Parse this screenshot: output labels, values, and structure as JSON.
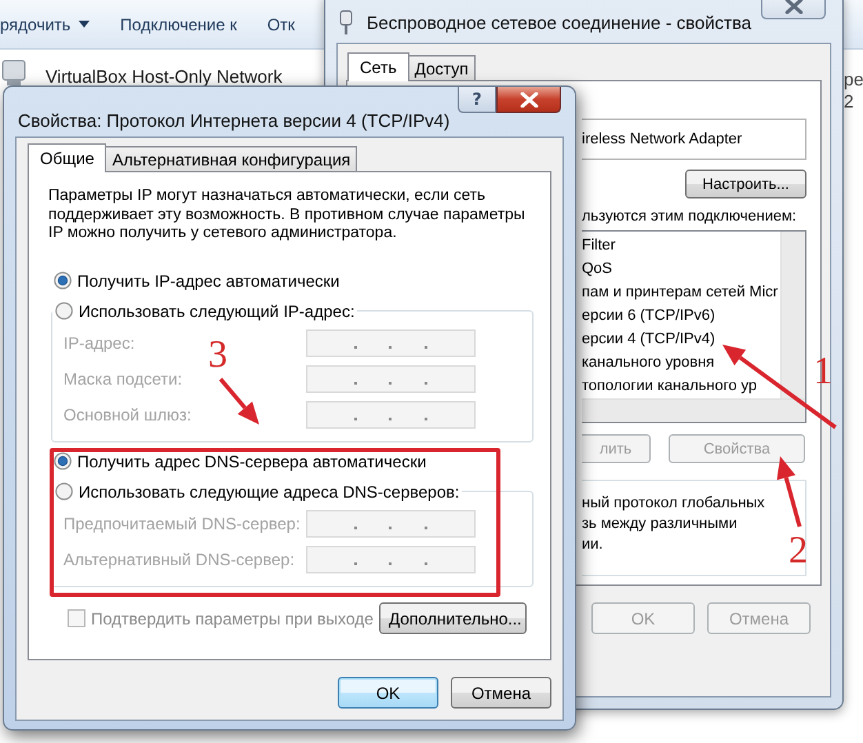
{
  "explorer": {
    "toolbar": [
      {
        "label": "рядочить",
        "kind": "menu"
      },
      {
        "label": "Подключение к",
        "kind": "plain"
      },
      {
        "label": "Отк",
        "kind": "plain"
      }
    ],
    "connections": [
      {
        "name": "VirtualBox Host-Only Network"
      }
    ],
    "edge_texts": [
      "ре",
      "2"
    ]
  },
  "back_window": {
    "title": "Беспроводное сетевое соединение - свойства",
    "tabs": [
      {
        "label": "Сеть",
        "selected": true
      },
      {
        "label": "Доступ",
        "selected": false
      }
    ],
    "adapter": "ireless Network Adapter",
    "configure_button": "Настроить...",
    "components_label": "льзуются этим подключением:",
    "components": [
      "Filter",
      "QoS",
      "пам и принтерам сетей Micr",
      "ерсии 6 (TCP/IPv6)",
      "ерсии 4 (TCP/IPv4)",
      "канального уровня",
      "топологии канального ур"
    ],
    "action_buttons": [
      {
        "label": "лить",
        "disabled": true
      },
      {
        "label": "Свойства",
        "disabled": true
      }
    ],
    "description": [
      "ный протокол глобальных",
      "зь между различными",
      "ии."
    ],
    "dialog_buttons": [
      {
        "label": "OK",
        "disabled": true
      },
      {
        "label": "Отмена",
        "disabled": true
      }
    ]
  },
  "front_window": {
    "title": "Свойства: Протокол Интернета версии 4 (TCP/IPv4)",
    "help_button": "?",
    "tabs": [
      {
        "label": "Общие",
        "selected": true
      },
      {
        "label": "Альтернативная конфигурация",
        "selected": false
      }
    ],
    "intro": "Параметры IP могут назначаться автоматически, если сеть поддерживает эту возможность. В противном случае параметры IP можно получить у сетевого администратора.",
    "ip_options": [
      {
        "label": "Получить IP-адрес автоматически",
        "selected": true
      },
      {
        "label": "Использовать следующий IP-адрес:",
        "selected": false
      }
    ],
    "ip_fields": [
      {
        "label": "IP-адрес:",
        "disabled": true
      },
      {
        "label": "Маска подсети:",
        "disabled": true
      },
      {
        "label": "Основной шлюз:",
        "disabled": true
      }
    ],
    "dns_options": [
      {
        "label": "Получить адрес DNS-сервера автоматически",
        "selected": true
      },
      {
        "label": "Использовать следующие адреса DNS-серверов:",
        "selected": false
      }
    ],
    "dns_fields": [
      {
        "label": "Предпочитаемый DNS-сервер:",
        "disabled": true
      },
      {
        "label": "Альтернативный DNS-сервер:",
        "disabled": true
      }
    ],
    "validate": {
      "label": "Подтвердить параметры при выходе",
      "checked": false,
      "disabled": true
    },
    "advanced_button": "Дополнительно...",
    "buttons": [
      {
        "label": "OK",
        "default": true
      },
      {
        "label": "Отмена",
        "default": false
      }
    ]
  },
  "annotations": [
    {
      "label": "1"
    },
    {
      "label": "2"
    },
    {
      "label": "3"
    }
  ]
}
